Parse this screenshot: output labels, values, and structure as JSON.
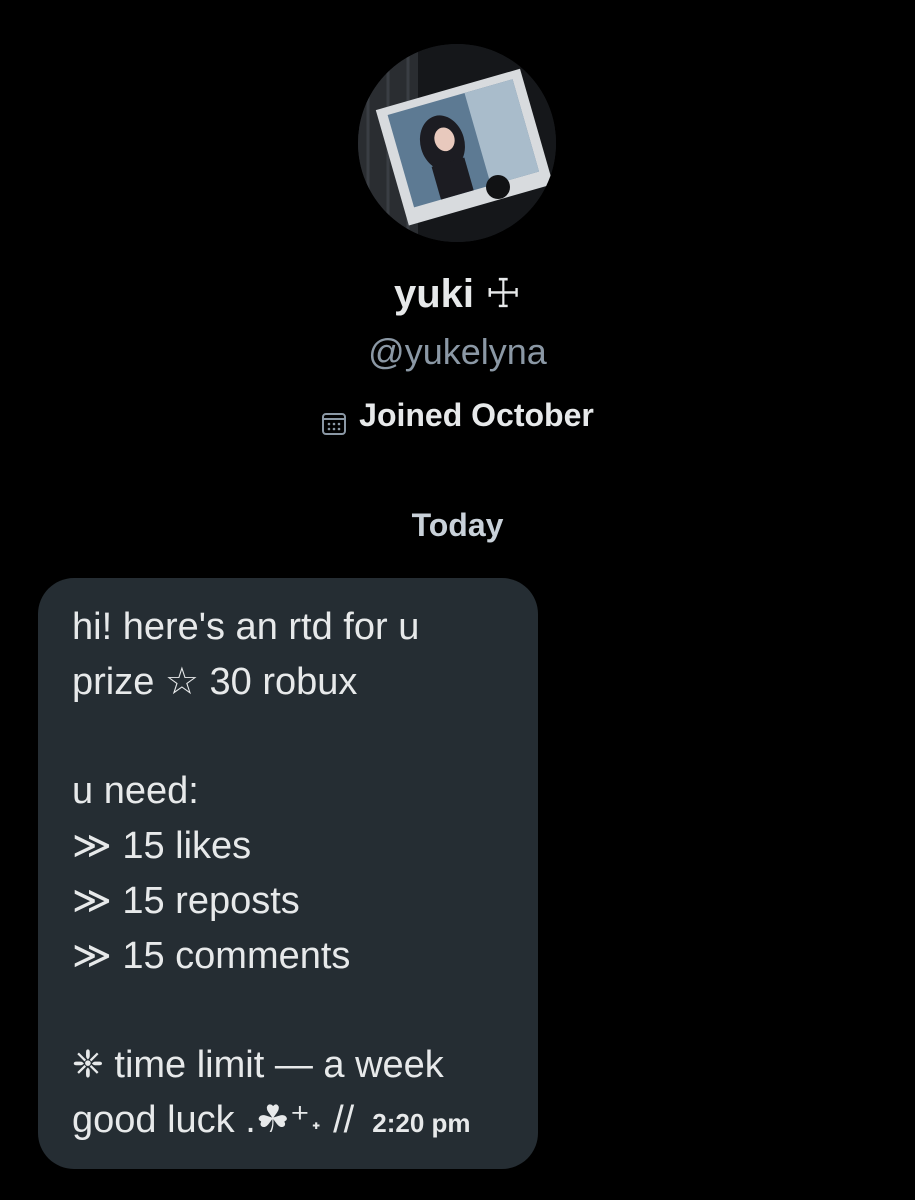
{
  "profile": {
    "display_name": "yuki ☩",
    "handle": "@yukelyna",
    "joined": "Joined October",
    "avatar_icon": "profile-photo"
  },
  "conversation": {
    "date_separator": "Today",
    "message": {
      "lines": [
        "hi! here's an rtd for u",
        "prize ☆ 30 robux",
        "",
        "u need:",
        "≫ 15 likes",
        "≫ 15 reposts",
        "≫ 15 comments",
        "",
        "❈ time limit — a week"
      ],
      "last_line": "good luck .☘︎⁺˖ //",
      "timestamp": "2:20 pm"
    }
  },
  "colors": {
    "background": "#000000",
    "bubble": "#252d33",
    "secondary_text": "#8b98a5"
  }
}
